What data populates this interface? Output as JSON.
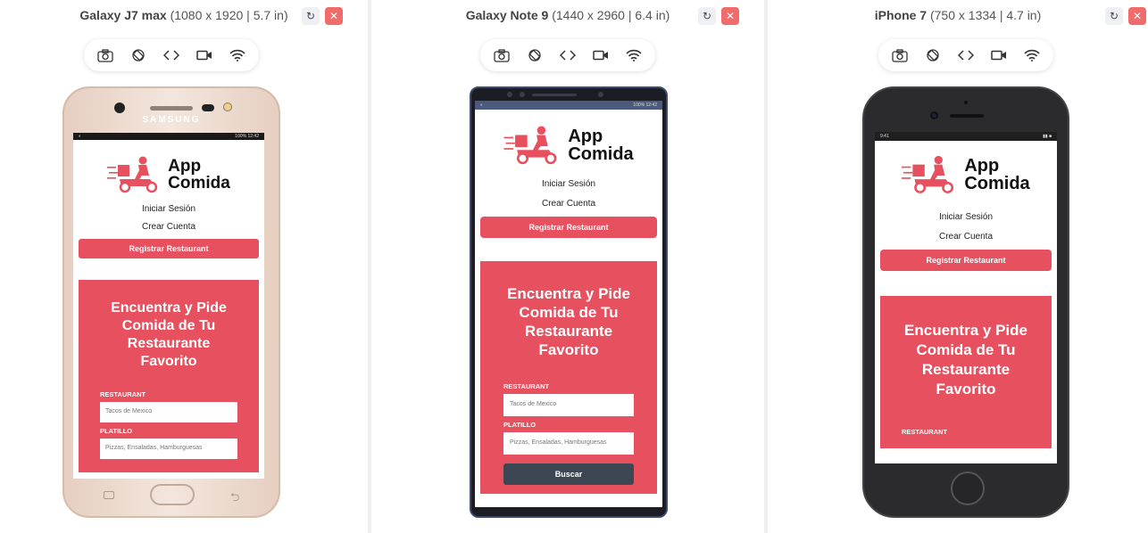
{
  "devices": [
    {
      "name": "Galaxy J7 max",
      "specs": "(1080 x 1920 | 5.7 in)",
      "brand": "SAMSUNG",
      "time": "12:42",
      "battery": "100%"
    },
    {
      "name": "Galaxy Note 9",
      "specs": "(1440 x 2960 | 6.4 in)",
      "time": "12:42",
      "battery": "100%"
    },
    {
      "name": "iPhone 7",
      "specs": "(750 x 1334 | 4.7 in)",
      "time": "9:41"
    }
  ],
  "toolbar": {
    "icons": [
      "camera-icon",
      "rotate-icon",
      "code-icon",
      "video-icon",
      "wifi-icon"
    ]
  },
  "app": {
    "logo_line1": "App",
    "logo_line2": "Comida",
    "nav_login": "Iniciar Sesión",
    "nav_signup": "Crear Cuenta",
    "register_button": "Registrar Restaurant",
    "hero_title": "Encuentra y Pide Comida de Tu Restaurante Favorito",
    "restaurant_label": "RESTAURANT",
    "restaurant_placeholder": "Tacos de Mexico",
    "platillo_label": "PLATILLO",
    "platillo_placeholder": "Pizzas, Ensaladas, Hamburguesas",
    "search_button": "Buscar"
  },
  "colors": {
    "brand": "#e7505e",
    "close": "#f16b6b",
    "button_dark": "#3d4653"
  }
}
